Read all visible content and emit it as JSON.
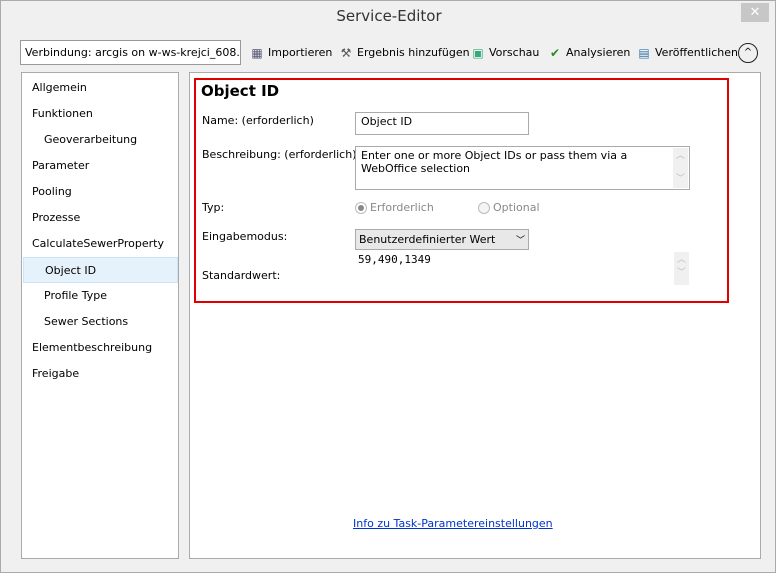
{
  "window": {
    "title": "Service-Editor",
    "close_label": "✕"
  },
  "toolbar": {
    "connection": "Verbindung: arcgis on w-ws-krejci_608...",
    "items": [
      {
        "label": "Importieren",
        "icon": "import-icon"
      },
      {
        "label": "Ergebnis hinzufügen",
        "icon": "hammer-icon"
      },
      {
        "label": "Vorschau",
        "icon": "preview-icon"
      },
      {
        "label": "Analysieren",
        "icon": "checkmark-icon"
      },
      {
        "label": "Veröffentlichen",
        "icon": "publish-icon"
      }
    ],
    "collapse_icon": "^"
  },
  "sidebar": {
    "items": [
      {
        "label": "Allgemein"
      },
      {
        "label": "Funktionen"
      },
      {
        "label": "Geoverarbeitung"
      },
      {
        "label": "Parameter"
      },
      {
        "label": "Pooling"
      },
      {
        "label": "Prozesse"
      },
      {
        "label": "CalculateSewerProperty"
      },
      {
        "label": "Object ID"
      },
      {
        "label": "Profile Type"
      },
      {
        "label": "Sewer Sections"
      },
      {
        "label": "Elementbeschreibung"
      },
      {
        "label": "Freigabe"
      }
    ]
  },
  "form": {
    "heading": "Object ID",
    "name_label": "Name:  (erforderlich)",
    "name_value": "Object ID",
    "desc_label": "Beschreibung:  (erforderlich):",
    "desc_value": "Enter one or more Object IDs or pass them via a WebOffice selection",
    "type_label": "Typ:",
    "type_required": "Erforderlich",
    "type_optional": "Optional",
    "mode_label": "Eingabemodus:",
    "mode_value": "Benutzerdefinierter Wert",
    "default_label": "Standardwert:",
    "default_value": "59,490,1349"
  },
  "help_link": "Info zu Task-Parametereinstellungen",
  "colors": {
    "highlight_border": "#e00000",
    "selected_item": "#e5f1fb",
    "link": "#0033cc"
  }
}
